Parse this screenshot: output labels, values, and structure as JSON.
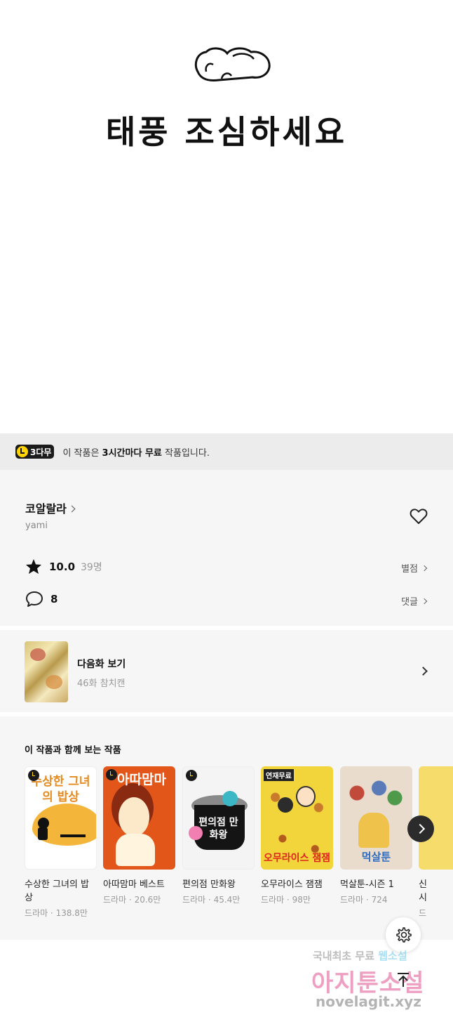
{
  "comic_panel": {
    "caption": "태풍 조심하세요"
  },
  "free_banner": {
    "badge_label": "3다무",
    "text_prefix": "이 작품은 ",
    "text_bold": "3시간마다 무료",
    "text_suffix": " 작품입니다."
  },
  "series": {
    "title": "코알랄라",
    "author": "yami",
    "rating_score": "10.0",
    "rating_count": "39명",
    "rating_link": "별점",
    "comment_count": "8",
    "comment_link": "댓글"
  },
  "next_episode": {
    "label": "다음화 보기",
    "episode": "46화 참치캔"
  },
  "recommendations": {
    "title": "이 작품과 함께 보는 작품",
    "items": [
      {
        "name": "수상한 그녀의 밥상",
        "name_line1": "수상한 그녀의 밥",
        "name_line2": "상",
        "meta": "드라마 · 138.8만",
        "cover_text": "수상한 그녀의 밥상"
      },
      {
        "name": "아따맘마 베스트",
        "meta": "드라마 · 20.6만",
        "cover_text": "아따맘마"
      },
      {
        "name": "편의점 만화왕",
        "meta": "드라마 · 45.4만",
        "cover_text": "편의점 만화왕"
      },
      {
        "name": "오무라이스 잼잼",
        "meta": "드라마 · 98만",
        "cover_text": "오무라이스 잼잼",
        "cover_tag": "연재무료"
      },
      {
        "name": "먹살툰-시즌 1",
        "meta": "드라마 · 724",
        "cover_text": "먹살툰"
      },
      {
        "name": "신",
        "name_line2": "시",
        "meta": "드"
      }
    ]
  },
  "watermark": {
    "line1_a": "국내최초 무료 ",
    "line1_b": "웹소설",
    "line2": "아지툰소설",
    "line3": "novelagit.xyz"
  },
  "colors": {
    "accent_yellow": "#ffd400",
    "badge_dark": "#1b1b1b",
    "panel_bg": "#f6f6f6",
    "banner_bg": "#ececec"
  },
  "icons": [
    "heart-icon",
    "star-icon",
    "comment-icon",
    "chevron-right-icon",
    "clock-icon",
    "gear-icon",
    "arrow-up-icon"
  ]
}
